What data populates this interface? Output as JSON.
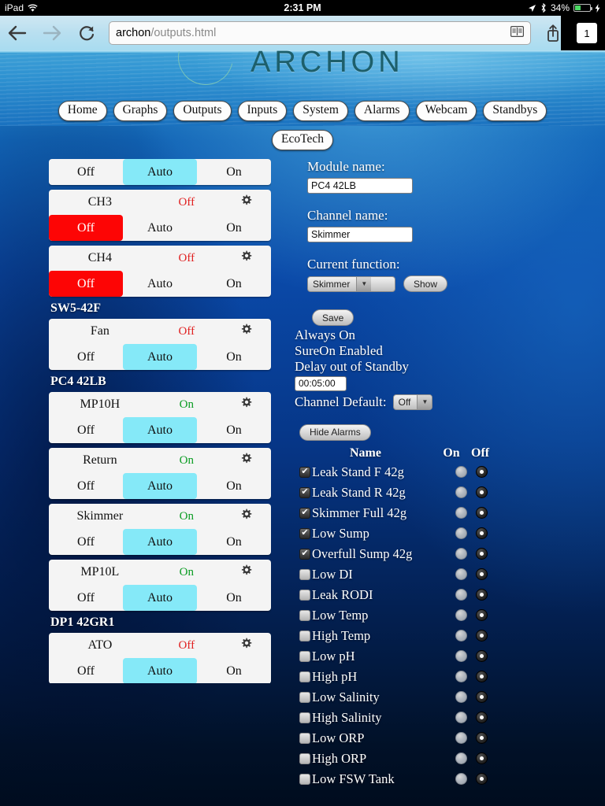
{
  "status_bar": {
    "device": "iPad",
    "wifi_icon": "wifi-icon",
    "time": "2:31 PM",
    "location_icon": "location-arrow-icon",
    "bluetooth_icon": "bluetooth-icon",
    "battery_percent": "34%",
    "charging_icon": "lightning-bolt-icon"
  },
  "browser": {
    "back_icon": "back-arrow-icon",
    "forward_icon": "forward-arrow-icon",
    "reload_icon": "reload-icon",
    "url_host": "archon",
    "url_path": "/outputs.html",
    "reader_icon": "reader-view-icon",
    "share_icon": "share-icon",
    "bookmark_icon": "star-icon",
    "tab_count": "1"
  },
  "site": {
    "logo_text": "ARCHON",
    "nav_primary": [
      {
        "label": "Home"
      },
      {
        "label": "Graphs"
      },
      {
        "label": "Outputs"
      },
      {
        "label": "Inputs"
      },
      {
        "label": "System"
      },
      {
        "label": "Alarms"
      },
      {
        "label": "Webcam"
      },
      {
        "label": "Standbys"
      }
    ],
    "nav_secondary": [
      {
        "label": "EcoTech"
      }
    ]
  },
  "segment_labels": {
    "off": "Off",
    "auto": "Auto",
    "on": "On"
  },
  "gear_icon": "gear-icon",
  "outputs": [
    {
      "kind": "channel",
      "partial_top": true,
      "name": "",
      "state": "",
      "selected": "auto"
    },
    {
      "kind": "channel",
      "name": "CH3",
      "state": "Off",
      "state_color": "off",
      "selected": "off"
    },
    {
      "kind": "channel",
      "name": "CH4",
      "state": "Off",
      "state_color": "off",
      "selected": "off"
    },
    {
      "kind": "group",
      "label": "SW5-42F"
    },
    {
      "kind": "channel",
      "name": "Fan",
      "state": "Off",
      "state_color": "off",
      "selected": "auto"
    },
    {
      "kind": "group",
      "label": "PC4 42LB"
    },
    {
      "kind": "channel",
      "name": "MP10H",
      "state": "On",
      "state_color": "on",
      "selected": "auto"
    },
    {
      "kind": "channel",
      "name": "Return",
      "state": "On",
      "state_color": "on",
      "selected": "auto"
    },
    {
      "kind": "channel",
      "name": "Skimmer",
      "state": "On",
      "state_color": "on",
      "selected": "auto"
    },
    {
      "kind": "channel",
      "name": "MP10L",
      "state": "On",
      "state_color": "on",
      "selected": "auto"
    },
    {
      "kind": "group",
      "label": "DP1 42GR1"
    },
    {
      "kind": "channel",
      "name": "ATO",
      "state": "Off",
      "state_color": "off",
      "selected": "auto"
    }
  ],
  "detail": {
    "module_name_label": "Module name:",
    "module_name_value": "PC4 42LB",
    "channel_name_label": "Channel name:",
    "channel_name_value": "Skimmer",
    "current_function_label": "Current function:",
    "current_function_value": "Skimmer",
    "show_button": "Show",
    "save_button": "Save",
    "always_on": "Always On",
    "sure_on": "SureOn Enabled",
    "delay_label": "Delay out of Standby",
    "delay_value": "00:05:00",
    "channel_default_label": "Channel Default:",
    "channel_default_value": "Off",
    "hide_alarms_button": "Hide Alarms"
  },
  "alarms": {
    "header": {
      "name": "Name",
      "on": "On",
      "off": "Off"
    },
    "check_glyph": "✔",
    "rows": [
      {
        "name": "Leak Stand F 42g",
        "checked": true,
        "action": "off"
      },
      {
        "name": "Leak Stand R 42g",
        "checked": true,
        "action": "off"
      },
      {
        "name": "Skimmer Full 42g",
        "checked": true,
        "action": "off"
      },
      {
        "name": "Low Sump",
        "checked": true,
        "action": "off"
      },
      {
        "name": "Overfull Sump 42g",
        "checked": true,
        "action": "off"
      },
      {
        "name": "Low DI",
        "checked": false,
        "action": "off"
      },
      {
        "name": "Leak RODI",
        "checked": false,
        "action": "off"
      },
      {
        "name": "Low Temp",
        "checked": false,
        "action": "off"
      },
      {
        "name": "High Temp",
        "checked": false,
        "action": "off"
      },
      {
        "name": "Low pH",
        "checked": false,
        "action": "off"
      },
      {
        "name": "High pH",
        "checked": false,
        "action": "off"
      },
      {
        "name": "Low Salinity",
        "checked": false,
        "action": "off"
      },
      {
        "name": "High Salinity",
        "checked": false,
        "action": "off"
      },
      {
        "name": "Low ORP",
        "checked": false,
        "action": "off"
      },
      {
        "name": "High ORP",
        "checked": false,
        "action": "off"
      },
      {
        "name": "Low FSW Tank",
        "checked": false,
        "action": "off"
      }
    ]
  },
  "colors": {
    "auto_selected": "#85e9f8",
    "off_selected": "#fd0505",
    "state_on": "#0a9c22",
    "state_off": "#e02020",
    "page_top": "#2a8cc8",
    "page_bottom": "#000c1e"
  }
}
